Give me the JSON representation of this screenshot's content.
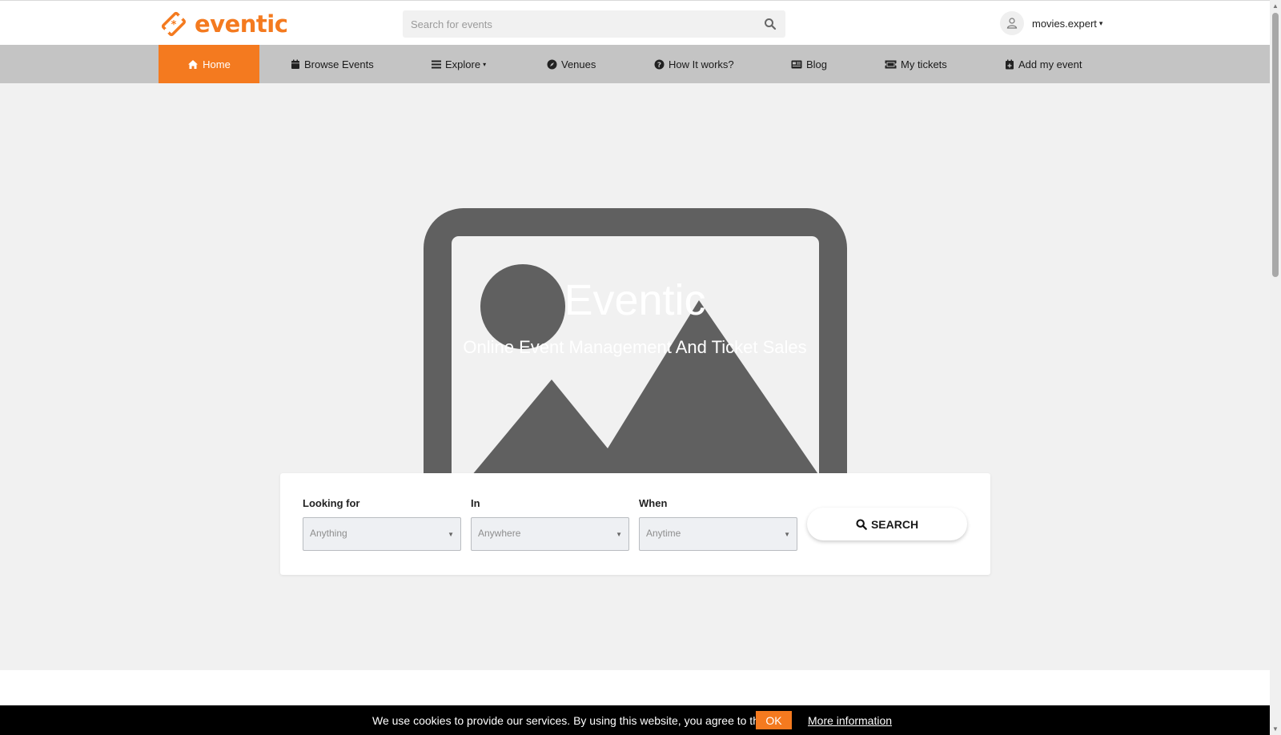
{
  "brand": {
    "name": "eventic",
    "accent": "#f47a1f"
  },
  "search": {
    "placeholder": "Search for events",
    "value": ""
  },
  "user": {
    "name": "movies.expert",
    "caret": "▾"
  },
  "nav": {
    "items": [
      {
        "label": "Home",
        "icon": "home-icon",
        "active": true
      },
      {
        "label": "Browse Events",
        "icon": "calendar-icon"
      },
      {
        "label": "Explore",
        "icon": "menu-icon",
        "caret": "▾"
      },
      {
        "label": "Venues",
        "icon": "compass-icon"
      },
      {
        "label": "How It works?",
        "icon": "question-icon"
      },
      {
        "label": "Blog",
        "icon": "newspaper-icon"
      },
      {
        "label": "My tickets",
        "icon": "ticket-icon"
      },
      {
        "label": "Add my event",
        "icon": "calendar-plus-icon"
      }
    ]
  },
  "hero": {
    "title": "Eventic",
    "subtitle": "Online Event Management And Ticket Sales"
  },
  "search_panel": {
    "fields": [
      {
        "label": "Looking for",
        "value": "Anything"
      },
      {
        "label": "In",
        "value": "Anywhere"
      },
      {
        "label": "When",
        "value": "Anytime"
      }
    ],
    "button_label": "SEARCH"
  },
  "cookie": {
    "text": "We use cookies to provide our services. By using this website, you agree to this.",
    "ok_label": "OK",
    "more_label": "More information"
  },
  "scrollbar": {
    "up": "▲",
    "down": "▼"
  }
}
